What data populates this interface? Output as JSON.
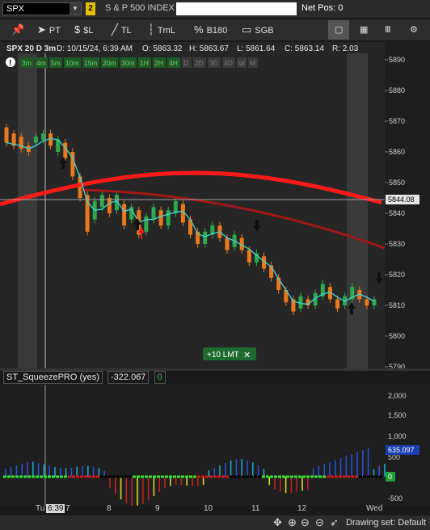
{
  "header": {
    "symbol": "SPX",
    "link_number": "2",
    "description": "S & P 500 INDEX",
    "net_pos": "Net Pos: 0"
  },
  "toolbar": {
    "pt_label": "PT",
    "dollar_label": "$L",
    "tl_label": "TL",
    "tml_label": "TmL",
    "b180_label": "B180",
    "sgb_label": "SGB"
  },
  "chart_info": {
    "symbol_period": "SPX 20 D 3m",
    "date": "D: 10/15/24, 6:39 AM",
    "open": "O: 5863.32",
    "high": "H: 5863.67",
    "low": "L: 5861.64",
    "close": "C: 5863.14",
    "range": "R: 2.03",
    "last_price_tag": "5844.08"
  },
  "timeframes": [
    "3m",
    "4m",
    "5m",
    "10m",
    "15m",
    "20m",
    "30m",
    "1H",
    "2H",
    "4H",
    "D",
    "2D",
    "3D",
    "4D",
    "W",
    "M"
  ],
  "order_label": "+10 LMT",
  "study": {
    "name": "ST_SqueezePRO (yes)",
    "value": "-322.067",
    "value2": "0",
    "price_tag": "635.097",
    "zero_tag": "0"
  },
  "price_axis": [
    "5890",
    "5880",
    "5870",
    "5860",
    "5850",
    "5840",
    "5830",
    "5820",
    "5810",
    "5800",
    "5790"
  ],
  "study_axis": [
    "2,000",
    "1,500",
    "1,000",
    "500",
    "-500"
  ],
  "time_axis": [
    "Tu",
    "6:39",
    "7",
    "8",
    "9",
    "10",
    "11",
    "12",
    "Wed"
  ],
  "bottom": {
    "drawing_set": "Drawing set: Default"
  },
  "colors": {
    "candle_up": "#2fa84f",
    "candle_down": "#e8791c",
    "sma_fast": "#3fd6d6",
    "ma_red": "#ff1a1a",
    "ma_darkred": "#a01818",
    "highlight_column": "#3a3a3a",
    "order_green": "#1f6a2e"
  },
  "icons": [
    "pin-icon",
    "cursor-icon",
    "dollar-icon",
    "trendline-icon",
    "time-icon",
    "percent-icon",
    "b180-icon",
    "square-icon",
    "grid-icon",
    "bars-icon",
    "gear-icon",
    "exclaim-icon",
    "crosshair-icon",
    "zoom-in-icon",
    "zoom-out-icon",
    "pan-icon"
  ]
}
